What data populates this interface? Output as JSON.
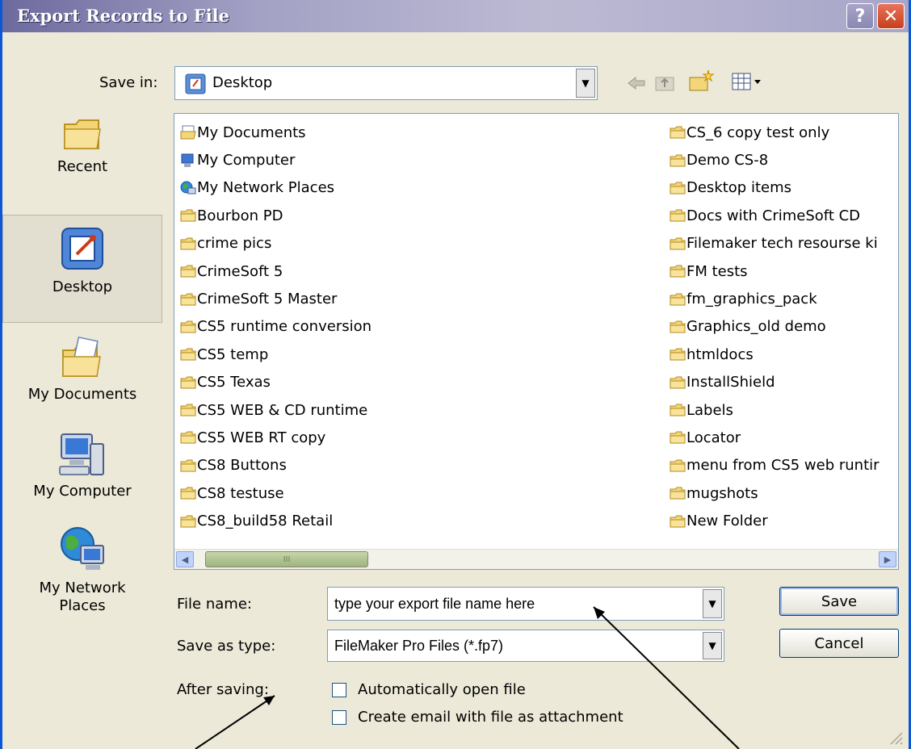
{
  "window": {
    "title": "Export Records to File",
    "help_glyph": "?",
    "close_glyph": "✕"
  },
  "save_in": {
    "label": "Save in:",
    "value": "Desktop"
  },
  "toolbar": {
    "icons": [
      "back-arrow-icon",
      "up-folder-icon",
      "new-folder-icon",
      "view-menu-icon"
    ]
  },
  "places": [
    {
      "label": "Recent",
      "icon": "recent-folder-icon"
    },
    {
      "label": "Desktop",
      "icon": "desktop-icon",
      "selected": true
    },
    {
      "label": "My Documents",
      "icon": "my-documents-icon"
    },
    {
      "label": "My Computer",
      "icon": "my-computer-icon"
    },
    {
      "label": "My Network Places",
      "icon": "my-network-places-icon"
    }
  ],
  "files": {
    "left": [
      {
        "name": "My Documents",
        "icon": "my-documents-icon"
      },
      {
        "name": "My Computer",
        "icon": "my-computer-icon"
      },
      {
        "name": "My Network Places",
        "icon": "my-network-places-icon"
      },
      {
        "name": "Bourbon PD",
        "icon": "folder-icon"
      },
      {
        "name": "crime pics",
        "icon": "folder-icon"
      },
      {
        "name": "CrimeSoft 5",
        "icon": "folder-icon"
      },
      {
        "name": "CrimeSoft 5 Master",
        "icon": "folder-icon"
      },
      {
        "name": "CS5 runtime conversion",
        "icon": "folder-icon"
      },
      {
        "name": "CS5 temp",
        "icon": "folder-icon"
      },
      {
        "name": "CS5 Texas",
        "icon": "folder-icon"
      },
      {
        "name": "CS5 WEB & CD runtime",
        "icon": "folder-icon"
      },
      {
        "name": "CS5 WEB RT copy",
        "icon": "folder-icon"
      },
      {
        "name": "CS8 Buttons",
        "icon": "folder-icon"
      },
      {
        "name": "CS8 testuse",
        "icon": "folder-icon"
      },
      {
        "name": "CS8_build58 Retail",
        "icon": "folder-icon"
      }
    ],
    "right": [
      {
        "name": "CS_6 copy test only",
        "icon": "folder-icon"
      },
      {
        "name": "Demo CS-8",
        "icon": "folder-icon"
      },
      {
        "name": "Desktop items",
        "icon": "folder-icon"
      },
      {
        "name": "Docs with CrimeSoft CD",
        "icon": "folder-icon"
      },
      {
        "name": "Filemaker tech resourse ki",
        "icon": "folder-icon"
      },
      {
        "name": "FM tests",
        "icon": "folder-icon"
      },
      {
        "name": "fm_graphics_pack",
        "icon": "folder-icon"
      },
      {
        "name": "Graphics_old demo",
        "icon": "folder-icon"
      },
      {
        "name": "htmldocs",
        "icon": "folder-icon"
      },
      {
        "name": "InstallShield",
        "icon": "folder-icon"
      },
      {
        "name": "Labels",
        "icon": "folder-icon"
      },
      {
        "name": "Locator",
        "icon": "folder-icon"
      },
      {
        "name": "menu from CS5 web runtir",
        "icon": "folder-icon"
      },
      {
        "name": "mugshots",
        "icon": "folder-icon"
      },
      {
        "name": "New Folder",
        "icon": "folder-icon"
      }
    ]
  },
  "scrollbar": {
    "thumb_grip": "III",
    "left_arrow": "◀",
    "right_arrow": "▶"
  },
  "form": {
    "file_name_label": "File name:",
    "file_name_value": "type your export file name here",
    "save_as_type_label": "Save as type:",
    "save_as_type_value": "FileMaker Pro Files (*.fp7)",
    "after_saving_label": "After saving:",
    "option_open": "Automatically open file",
    "option_email": "Create email with file as attachment",
    "option_open_checked": false,
    "option_email_checked": false
  },
  "buttons": {
    "save": "Save",
    "cancel": "Cancel"
  },
  "combo_arrow_glyph": "▼",
  "colors": {
    "title_bar": "#a3a1c4",
    "dialog_bg": "#ece9d8",
    "close_button": "#d0502b",
    "folder": "#f3d67a"
  }
}
